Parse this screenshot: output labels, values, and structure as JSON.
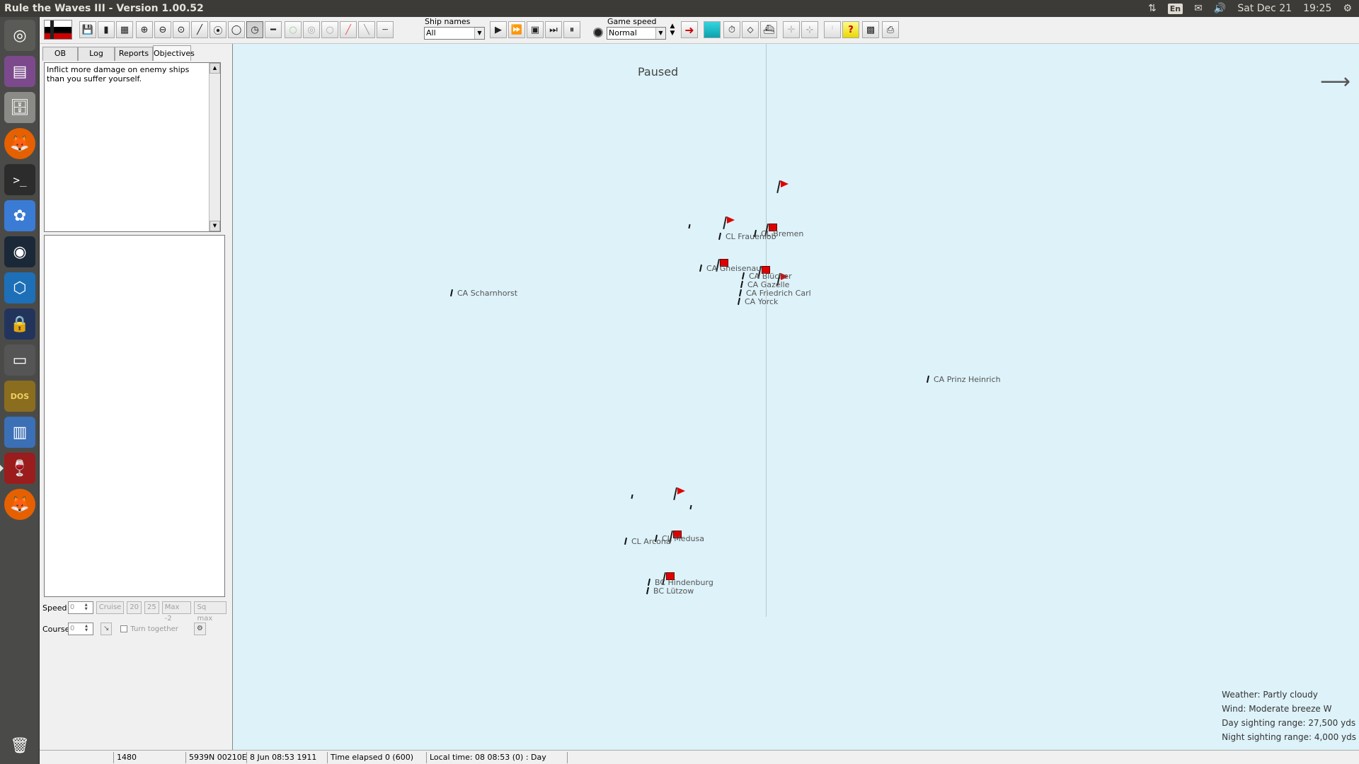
{
  "system_panel": {
    "window_title": "Rule the Waves III - Version 1.00.52",
    "language": "En",
    "date": "Sat Dec 21",
    "time": "19:25"
  },
  "launcher": {
    "items": [
      "dash-home",
      "workspace-switcher",
      "files",
      "firefox",
      "terminal",
      "photos",
      "steam",
      "virtualbox",
      "lock-app",
      "app-window",
      "dosbox",
      "text-editor",
      "wine",
      "firefox-alt",
      "trash"
    ]
  },
  "toolbar": {
    "ship_names_label": "Ship names",
    "ship_names_value": "All",
    "game_speed_label": "Game speed",
    "game_speed_value": "Normal"
  },
  "left_panel": {
    "tabs": [
      "OB",
      "Log",
      "Reports",
      "Objectives"
    ],
    "selected_tab": "Objectives",
    "objectives_text": "Inflict more damage on enemy ships than you suffer yourself.",
    "speed_label": "Speed",
    "speed_value": "0",
    "speed_buttons": [
      "Cruise",
      "20",
      "25",
      "Max -2",
      "Sq max"
    ],
    "course_label": "Course",
    "course_value": "0",
    "turn_together_label": "Turn together"
  },
  "map": {
    "status": "Paused",
    "ships": [
      "CL Bremen",
      "CL Frauenlob",
      "CA Gneisenau",
      "CA Blücher",
      "CA Gazelle",
      "CA Friedrich Carl",
      "CA Yorck",
      "CA Scharnhorst",
      "CA Prinz Heinrich",
      "CL Medusa",
      "CL Arcona",
      "BC Hindenburg",
      "BC Lützow"
    ],
    "weather": "Weather: Partly cloudy",
    "wind": "Wind: Moderate breeze  W",
    "day_sighting": "Day sighting range: 27,500 yds",
    "night_sighting": "Night sighting range: 4,000 yds"
  },
  "status_bar": {
    "scale": "1480",
    "position": "5939N 00210E",
    "date_time": "8 Jun 08:53 1911",
    "elapsed": "Time elapsed 0 (600)",
    "local_time": "Local time: 08 08:53 (0) : Day"
  }
}
